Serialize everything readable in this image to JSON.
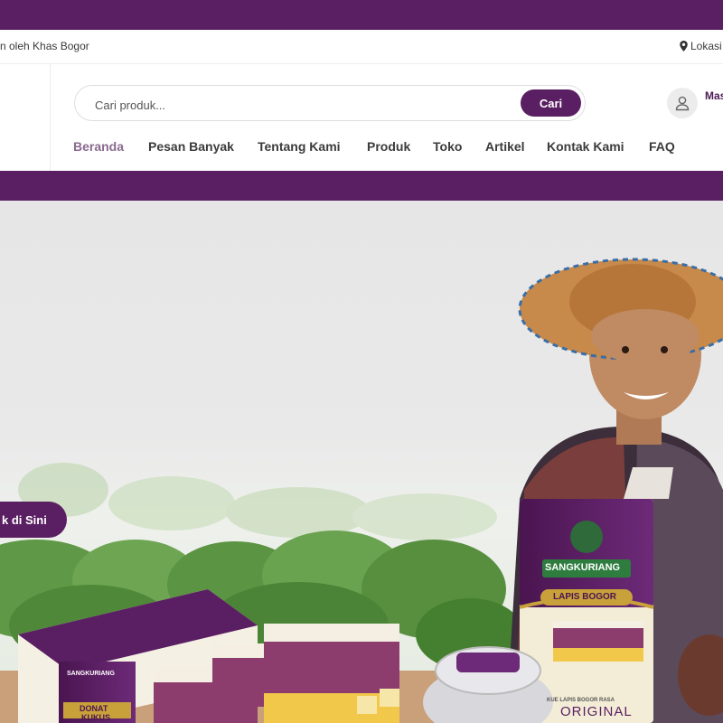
{
  "infobar": {
    "left_text": "n oleh Khas Bogor",
    "right_text": "Lokasi"
  },
  "header": {
    "search": {
      "placeholder": "Cari produk...",
      "button_label": "Cari"
    },
    "account": {
      "label": "Mas"
    }
  },
  "nav": {
    "items": [
      {
        "label": "Beranda",
        "active": true
      },
      {
        "label": "Pesan Banyak"
      },
      {
        "label": "Tentang Kami"
      },
      {
        "label": "Produk"
      },
      {
        "label": "Toko"
      },
      {
        "label": "Artikel"
      },
      {
        "label": "Kontak Kami"
      },
      {
        "label": "FAQ"
      }
    ]
  },
  "hero": {
    "cta_label": "k di Sini",
    "product_box": {
      "brand": "SANGKURIANG",
      "product": "LAPIS BOGOR",
      "subtitle": "KUE LAPIS BOGOR RASA",
      "flavor": "ORIGINAL"
    },
    "donut_box": {
      "brand": "SANGKURIANG",
      "product": "DONAT",
      "product2": "KUKUS"
    }
  },
  "colors": {
    "brand_purple": "#5a1f62",
    "active_nav": "#8a6a8e",
    "gold": "#c9a13a"
  }
}
